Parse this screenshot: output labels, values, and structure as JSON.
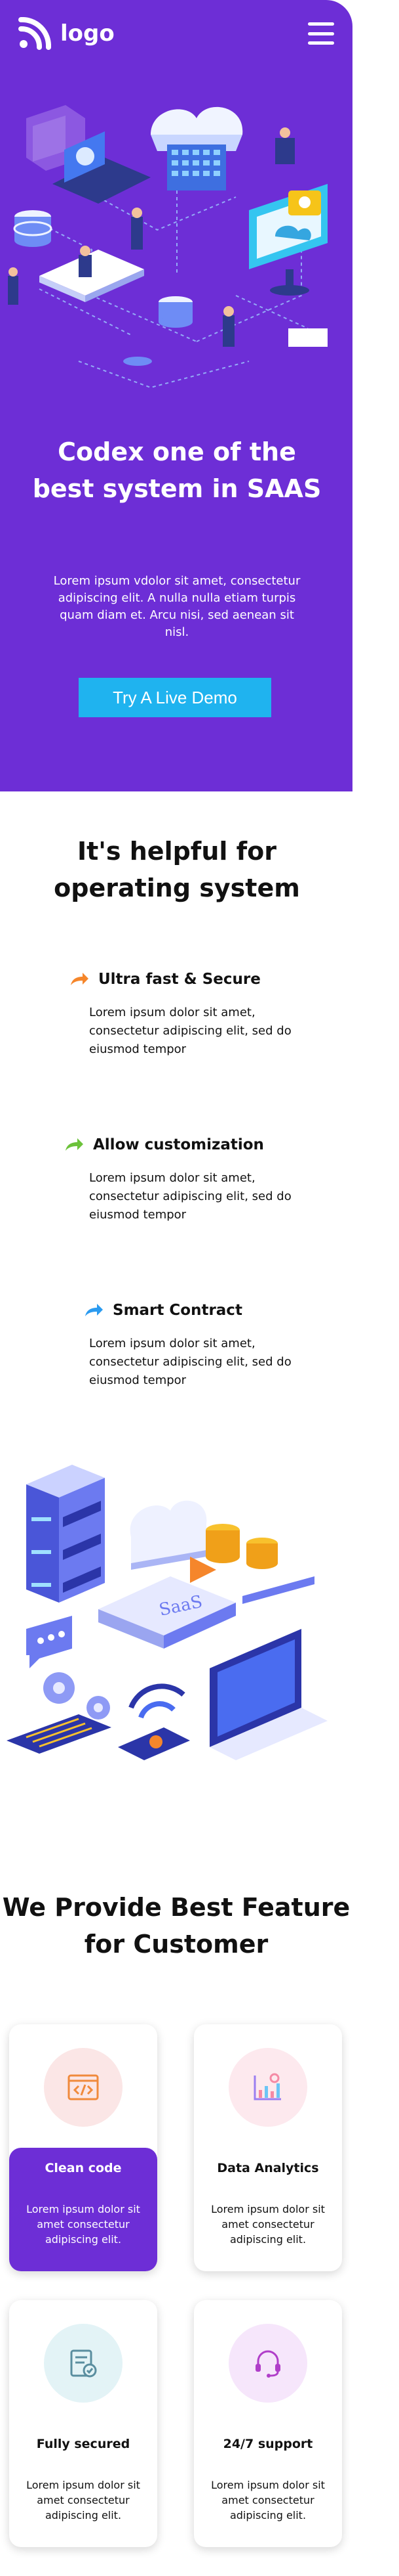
{
  "header": {
    "logo_text": "logo",
    "menu_icon": "hamburger-menu-icon"
  },
  "hero": {
    "title": "Codex one of the best system in SAAS",
    "text": "Lorem ipsum vdolor sit amet, consectetur adipiscing elit. A nulla nulla etiam turpis quam diam et. Arcu nisi, sed aenean sit nisl.",
    "cta_label": "Try A Live Demo"
  },
  "helpful": {
    "title": "It's helpful for operating system",
    "features": [
      {
        "name": "Ultra fast & Secure",
        "text": "Lorem ipsum dolor sit amet, consectetur adipiscing elit, sed do eiusmod tempor",
        "icon_color": "#f5862b"
      },
      {
        "name": "Allow customization",
        "text": "Lorem ipsum dolor sit amet, consectetur adipiscing elit, sed do eiusmod tempor",
        "icon_color": "#6cc23a"
      },
      {
        "name": "Smart Contract",
        "text": "Lorem ipsum dolor sit amet, consectetur adipiscing elit, sed do eiusmod tempor",
        "icon_color": "#2b9bf0"
      }
    ]
  },
  "best_features": {
    "title": "We Provide Best Feature for Customer",
    "cards": [
      {
        "name": "Clean code",
        "text": "Lorem ipsum dolor sit amet consectetur adipiscing elit.",
        "icon": "code-window-icon",
        "active": true
      },
      {
        "name": "Data Analytics",
        "text": "Lorem ipsum dolor sit amet consectetur adipiscing elit.",
        "icon": "analytics-chart-icon",
        "active": false
      },
      {
        "name": "Fully secured",
        "text": "Lorem ipsum dolor sit amet consectetur adipiscing elit.",
        "icon": "secure-document-icon",
        "active": false
      },
      {
        "name": "24/7 support",
        "text": "Lorem ipsum dolor sit amet consectetur adipiscing elit.",
        "icon": "headset-support-icon",
        "active": false
      }
    ]
  },
  "colors": {
    "brand_purple": "#6d2ed6",
    "cta_blue": "#1fb3ef"
  }
}
